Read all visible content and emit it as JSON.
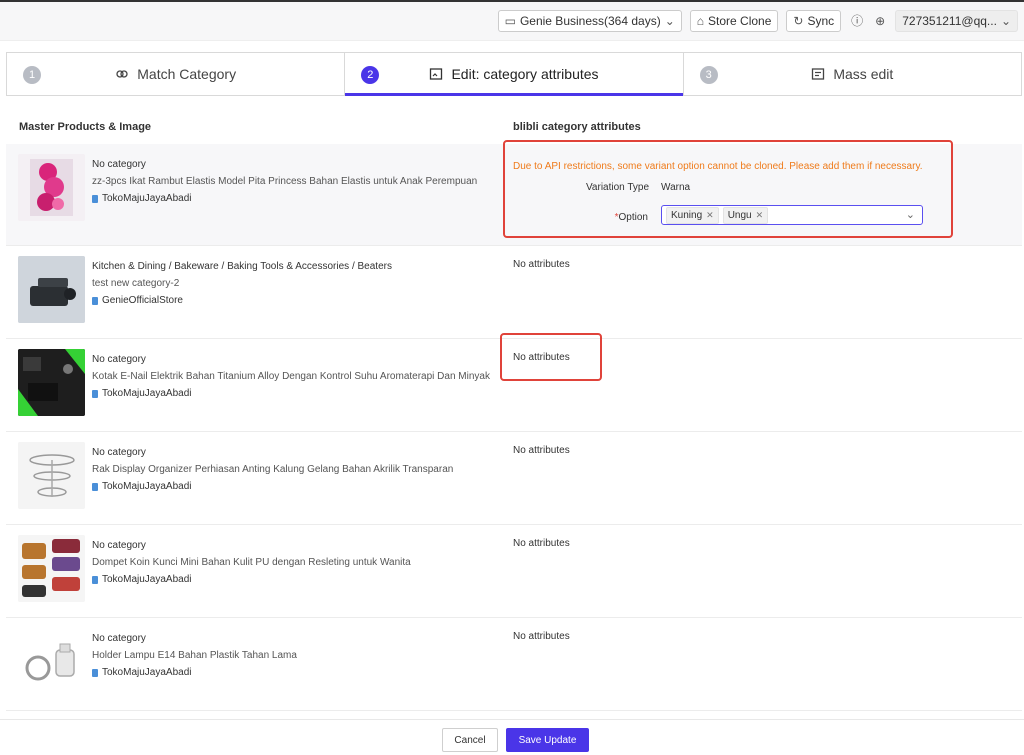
{
  "topbar": {
    "plan_label": "Genie Business(364 days)",
    "store_clone_label": "Store Clone",
    "sync_label": "Sync",
    "account_label": "727351211@qq..."
  },
  "steps": [
    {
      "number": "1",
      "label": "Match Category"
    },
    {
      "number": "2",
      "label": "Edit: category attributes"
    },
    {
      "number": "3",
      "label": "Mass edit"
    }
  ],
  "table": {
    "col_products": "Master Products & Image",
    "col_attributes": "blibli category attributes"
  },
  "rows": [
    {
      "category": "No category",
      "title": "zz-3pcs Ikat Rambut Elastis Model Pita Princess Bahan Elastis untuk Anak Perempuan",
      "store": "TokoMajuJayaAbadi",
      "attributes": ""
    },
    {
      "category": "Kitchen & Dining / Bakeware / Baking Tools & Accessories / Beaters",
      "title": "test new category-2",
      "store": "GenieOfficialStore",
      "attributes": "No attributes"
    },
    {
      "category": "No category",
      "title": "Kotak E-Nail Elektrik Bahan Titanium Alloy Dengan Kontrol Suhu Aromaterapi Dan Minyak",
      "store": "TokoMajuJayaAbadi",
      "attributes": "No attributes"
    },
    {
      "category": "No category",
      "title": "Rak Display Organizer Perhiasan Anting Kalung Gelang Bahan Akrilik Transparan",
      "store": "TokoMajuJayaAbadi",
      "attributes": "No attributes"
    },
    {
      "category": "No category",
      "title": "Dompet Koin Kunci Mini Bahan Kulit PU dengan Resleting untuk Wanita",
      "store": "TokoMajuJayaAbadi",
      "attributes": "No attributes"
    },
    {
      "category": "No category",
      "title": "Holder Lampu E14 Bahan Plastik Tahan Lama",
      "store": "TokoMajuJayaAbadi",
      "attributes": "No attributes"
    }
  ],
  "variant": {
    "warning": "Due to API restrictions, some variant option cannot be cloned. Please add them if necessary.",
    "variation_type_label": "Variation Type",
    "variation_type_value": "Warna",
    "option_required_mark": "*",
    "option_label": "Option",
    "tags": [
      "Kuning",
      "Ungu"
    ]
  },
  "footer": {
    "cancel_label": "Cancel",
    "save_label": "Save Update"
  },
  "colors": {
    "accent": "#4a35e8",
    "warning": "#ef7b1b",
    "highlight_border": "#e0433a"
  }
}
